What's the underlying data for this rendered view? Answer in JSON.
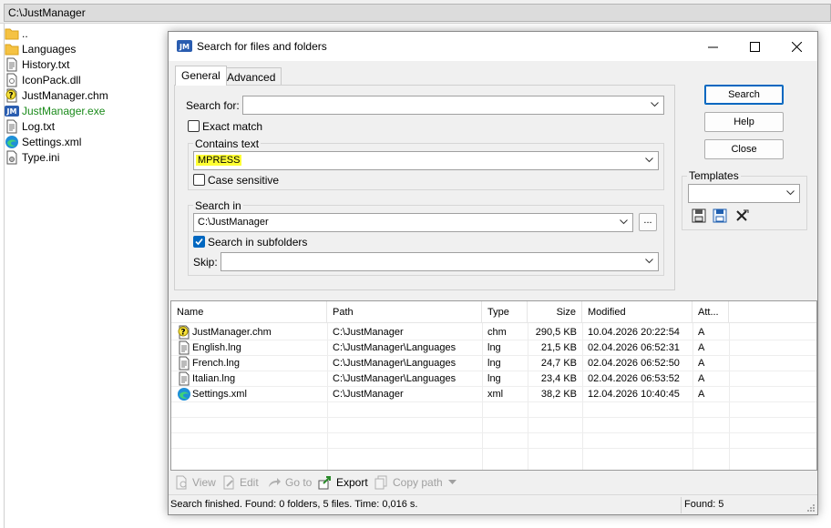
{
  "path_bar": {
    "path": "C:\\JustManager"
  },
  "file_list": [
    {
      "name": "..",
      "icon": "folder-icon",
      "color": "#000000"
    },
    {
      "name": "Languages",
      "icon": "folder-icon",
      "color": "#000000"
    },
    {
      "name": "History.txt",
      "icon": "text-file-icon",
      "color": "#000000"
    },
    {
      "name": "IconPack.dll",
      "icon": "dll-file-icon",
      "color": "#000000"
    },
    {
      "name": "JustManager.chm",
      "icon": "help-file-icon",
      "color": "#000000"
    },
    {
      "name": "JustManager.exe",
      "icon": "app-icon",
      "color": "#1a8a1a"
    },
    {
      "name": "Log.txt",
      "icon": "text-file-icon",
      "color": "#000000"
    },
    {
      "name": "Settings.xml",
      "icon": "edge-icon",
      "color": "#000000"
    },
    {
      "name": "Type.ini",
      "icon": "ini-file-icon",
      "color": "#000000"
    }
  ],
  "dialog": {
    "title": "Search for files and folders",
    "tabs": [
      "General",
      "Advanced"
    ],
    "search_for_label": "Search for:",
    "search_for_value": "",
    "exact_match_label": "Exact match",
    "exact_match_checked": false,
    "contains_text_label": "Contains text",
    "contains_text_value": "MPRESS",
    "highlight_color": "#ffff33",
    "case_sensitive_label": "Case sensitive",
    "case_sensitive_checked": false,
    "search_in_label": "Search in",
    "search_in_value": "C:\\JustManager",
    "browse_label": "...",
    "subfolders_label": "Search in subfolders",
    "subfolders_checked": true,
    "skip_label": "Skip:",
    "skip_value": "",
    "buttons": {
      "search": "Search",
      "help": "Help",
      "close": "Close"
    },
    "templates_label": "Templates",
    "templates_value": ""
  },
  "results": {
    "columns": [
      "Name",
      "Path",
      "Type",
      "Size",
      "Modified",
      "Att..."
    ],
    "rows": [
      {
        "name": "JustManager.chm",
        "icon": "help-file-icon",
        "path": "C:\\JustManager",
        "type": "chm",
        "size": "290,5 KB",
        "modified": "10.04.2026 20:22:54",
        "attr": "A"
      },
      {
        "name": "English.lng",
        "icon": "text-file-icon",
        "path": "C:\\JustManager\\Languages",
        "type": "lng",
        "size": "21,5 KB",
        "modified": "02.04.2026 06:52:31",
        "attr": "A"
      },
      {
        "name": "French.lng",
        "icon": "text-file-icon",
        "path": "C:\\JustManager\\Languages",
        "type": "lng",
        "size": "24,7 KB",
        "modified": "02.04.2026 06:52:50",
        "attr": "A"
      },
      {
        "name": "Italian.lng",
        "icon": "text-file-icon",
        "path": "C:\\JustManager\\Languages",
        "type": "lng",
        "size": "23,4 KB",
        "modified": "02.04.2026 06:53:52",
        "attr": "A"
      },
      {
        "name": "Settings.xml",
        "icon": "edge-icon",
        "path": "C:\\JustManager",
        "type": "xml",
        "size": "38,2 KB",
        "modified": "12.04.2026 10:40:45",
        "attr": "A"
      }
    ]
  },
  "toolbar": {
    "view": "View",
    "edit": "Edit",
    "goto": "Go to",
    "export": "Export",
    "copy_path": "Copy path"
  },
  "status": {
    "message": "Search finished. Found: 0 folders, 5 files. Time: 0,016 s.",
    "found": "Found: 5"
  }
}
